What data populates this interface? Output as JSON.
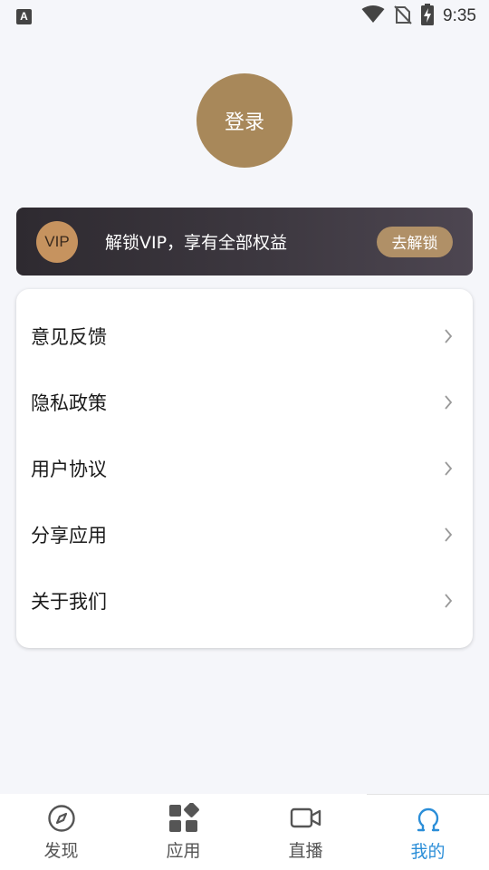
{
  "status_bar": {
    "left_icon": "A",
    "time": "9:35",
    "icons": [
      "wifi-icon",
      "no-sim-icon",
      "battery-charging-icon"
    ]
  },
  "profile": {
    "login_label": "登录",
    "avatar_color": "#a8885a"
  },
  "vip": {
    "badge": "VIP",
    "text": "解锁VIP，享有全部权益",
    "button": "去解锁"
  },
  "menu": {
    "items": [
      {
        "label": "意见反馈"
      },
      {
        "label": "隐私政策"
      },
      {
        "label": "用户协议"
      },
      {
        "label": "分享应用"
      },
      {
        "label": "关于我们"
      }
    ]
  },
  "bottom_nav": {
    "items": [
      {
        "label": "发现",
        "icon": "compass-icon"
      },
      {
        "label": "应用",
        "icon": "apps-grid-icon"
      },
      {
        "label": "直播",
        "icon": "video-camera-icon"
      },
      {
        "label": "我的",
        "icon": "profile-icon",
        "active": true
      }
    ],
    "active_color": "#2b8ed8"
  }
}
